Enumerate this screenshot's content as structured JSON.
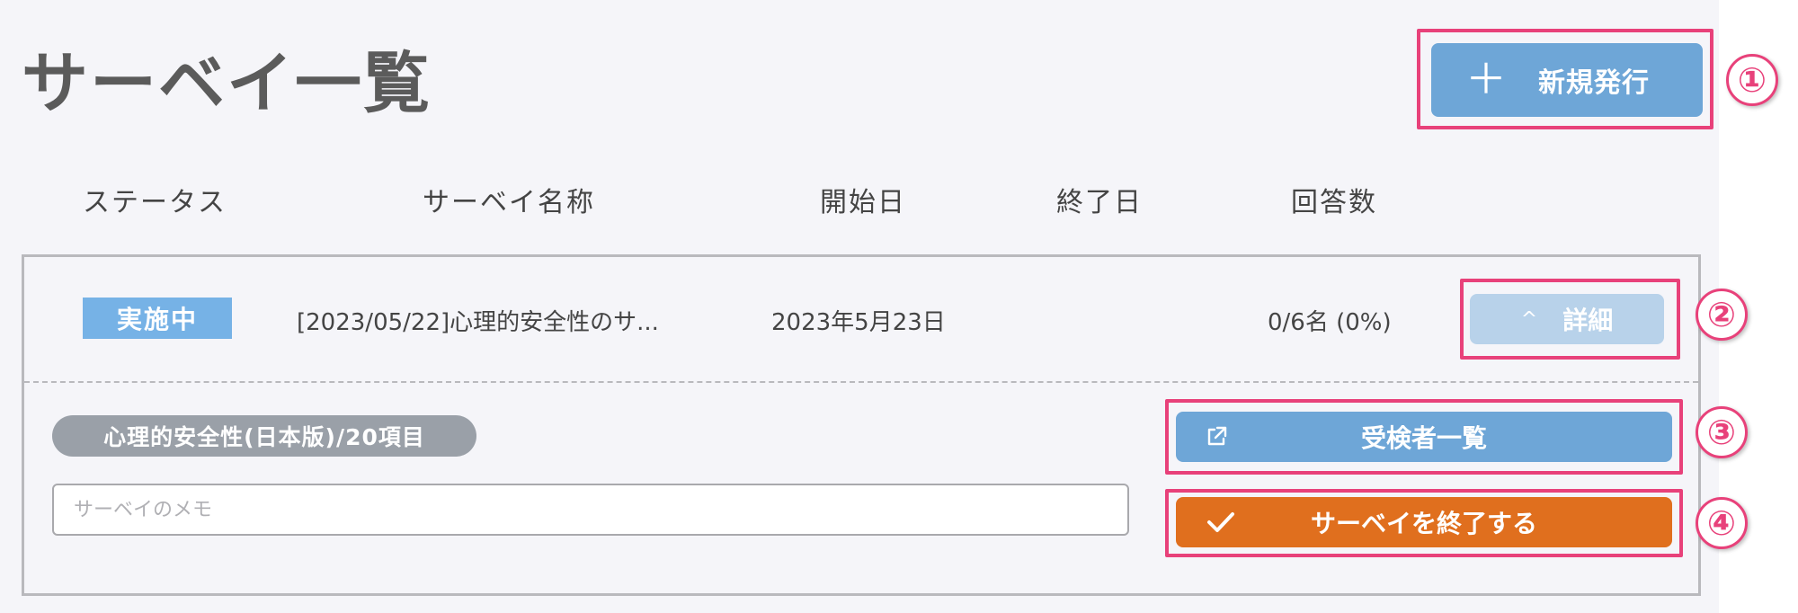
{
  "page": {
    "title": "サーベイ一覧"
  },
  "toolbar": {
    "new_button_label": "新規発行",
    "plus_icon": "＋"
  },
  "table": {
    "headers": [
      "ステータス",
      "サーベイ名称",
      "開始日",
      "終了日",
      "回答数"
    ]
  },
  "survey": {
    "status": "実施中",
    "name": "[2023/05/22]心理的安全性のサ...",
    "start_date": "2023年5月23日",
    "end_date": "",
    "responses": "0/6名 (0%)",
    "detail_button_label": "詳細",
    "detail_chevron": "^",
    "tag": "心理的安全性(日本版)/20項目",
    "memo_placeholder": "サーベイのメモ",
    "memo_value": "",
    "examinees_button_label": "受検者一覧",
    "end_survey_button_label": "サーベイを終了する"
  },
  "annotations": [
    "①",
    "②",
    "③",
    "④"
  ],
  "colors": {
    "background": "#f5f5f9",
    "primary_button": "#6ea6d7",
    "detail_button": "#b8d2ea",
    "status_badge": "#76b2e6",
    "end_button": "#e06f1e",
    "tag": "#9aa0a8",
    "annotation": "#e8417a"
  },
  "icons": {
    "new": "plus-icon",
    "detail": "chevron-up-icon",
    "examinees": "external-link-icon",
    "end": "check-icon"
  }
}
